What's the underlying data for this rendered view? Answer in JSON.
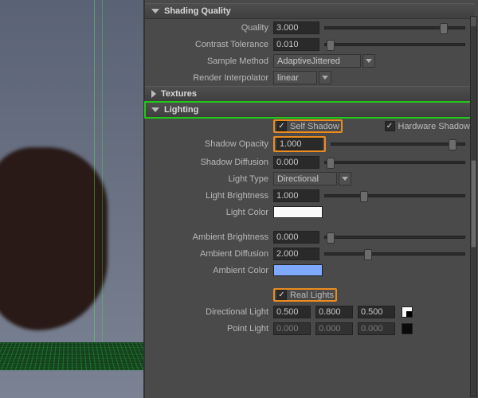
{
  "sections": {
    "shading_quality": "Shading Quality",
    "textures": "Textures",
    "lighting": "Lighting"
  },
  "shading": {
    "quality_label": "Quality",
    "quality_value": "3.000",
    "contrast_label": "Contrast Tolerance",
    "contrast_value": "0.010",
    "sample_label": "Sample Method",
    "sample_value": "AdaptiveJittered",
    "interp_label": "Render Interpolator",
    "interp_value": "linear"
  },
  "lighting": {
    "self_shadow_label": "Self Shadow",
    "self_shadow_checked": true,
    "hw_shadow_label": "Hardware Shadow",
    "hw_shadow_checked": true,
    "shadow_opacity_label": "Shadow Opacity",
    "shadow_opacity_value": "1.000",
    "shadow_diffusion_label": "Shadow Diffusion",
    "shadow_diffusion_value": "0.000",
    "light_type_label": "Light Type",
    "light_type_value": "Directional",
    "light_brightness_label": "Light Brightness",
    "light_brightness_value": "1.000",
    "light_color_label": "Light Color",
    "light_color_value": "#ffffff",
    "ambient_brightness_label": "Ambient Brightness",
    "ambient_brightness_value": "0.000",
    "ambient_diffusion_label": "Ambient Diffusion",
    "ambient_diffusion_value": "2.000",
    "ambient_color_label": "Ambient Color",
    "ambient_color_value": "#7fa9ff",
    "real_lights_label": "Real Lights",
    "real_lights_checked": true,
    "directional_light_label": "Directional Light",
    "directional_light_values": [
      "0.500",
      "0.800",
      "0.500"
    ],
    "point_light_label": "Point Light",
    "point_light_values": [
      "0.000",
      "0.000",
      "0.000"
    ]
  },
  "slider_positions": {
    "quality": 0.82,
    "contrast": 0.01,
    "shadow_opacity": 0.88,
    "shadow_diffusion": 0.01,
    "light_brightness": 0.25,
    "ambient_brightness": 0.01,
    "ambient_diffusion": 0.28
  },
  "colors": {
    "highlight_orange": "#eb8c1e",
    "highlight_green": "#22c818"
  }
}
